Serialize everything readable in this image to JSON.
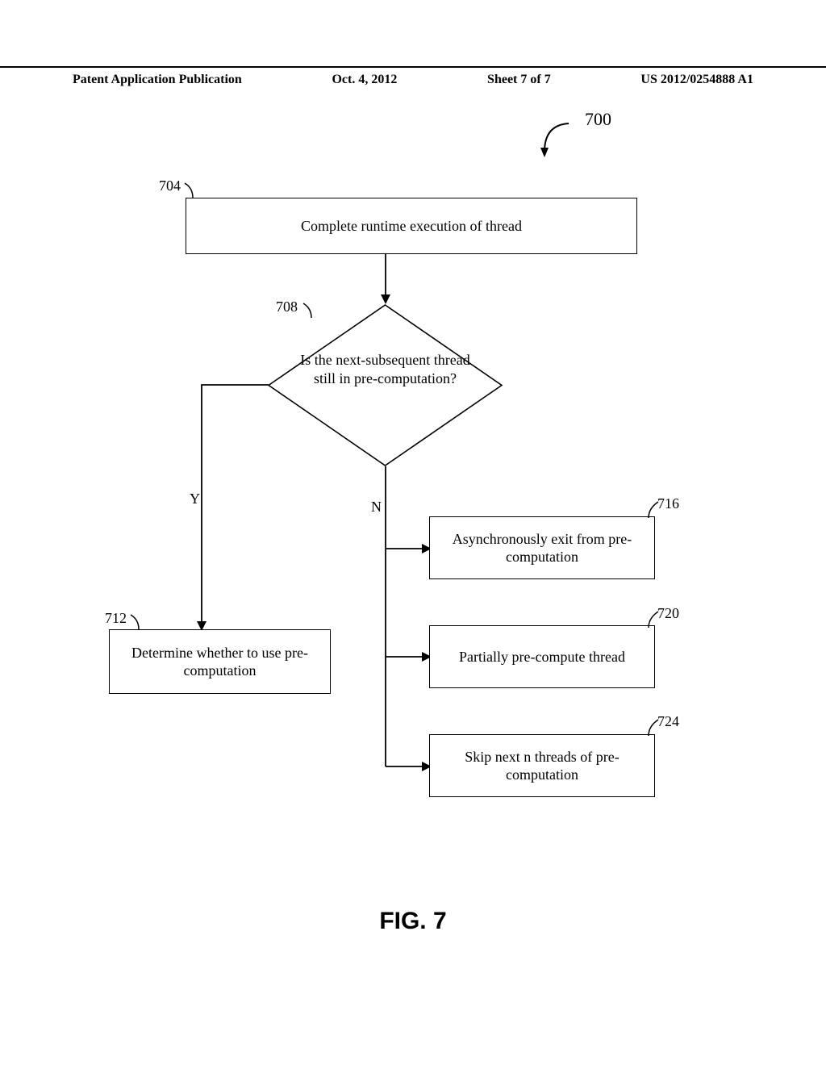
{
  "header": {
    "publication_type": "Patent Application Publication",
    "date": "Oct. 4, 2012",
    "sheet": "Sheet 7 of 7",
    "pub_number": "US 2012/0254888 A1"
  },
  "figure": {
    "main_ref": "700",
    "caption": "FIG. 7"
  },
  "refs": {
    "r704": "704",
    "r708": "708",
    "r712": "712",
    "r716": "716",
    "r720": "720",
    "r724": "724"
  },
  "boxes": {
    "b704": "Complete runtime execution of thread",
    "b712": "Determine whether to use pre-computation",
    "b716": "Asynchronously exit from pre-computation",
    "b720": "Partially pre-compute thread",
    "b724": "Skip next n threads of pre-computation"
  },
  "decision": {
    "text": "Is the next-subsequent thread still in pre-computation?",
    "yes": "Y",
    "no": "N"
  },
  "chart_data": {
    "type": "flowchart",
    "title": "FIG. 7",
    "ref": "700",
    "nodes": [
      {
        "id": "704",
        "type": "process",
        "label": "Complete runtime execution of thread"
      },
      {
        "id": "708",
        "type": "decision",
        "label": "Is the next-subsequent thread still in pre-computation?"
      },
      {
        "id": "712",
        "type": "process",
        "label": "Determine whether to use pre-computation"
      },
      {
        "id": "716",
        "type": "process",
        "label": "Asynchronously exit from pre-computation"
      },
      {
        "id": "720",
        "type": "process",
        "label": "Partially pre-compute thread"
      },
      {
        "id": "724",
        "type": "process",
        "label": "Skip next n threads of pre-computation"
      }
    ],
    "edges": [
      {
        "from": "704",
        "to": "708",
        "label": ""
      },
      {
        "from": "708",
        "to": "712",
        "label": "Y"
      },
      {
        "from": "708",
        "to": "716",
        "label": "N"
      },
      {
        "from": "708",
        "to": "720",
        "label": "N"
      },
      {
        "from": "708",
        "to": "724",
        "label": "N"
      }
    ]
  }
}
